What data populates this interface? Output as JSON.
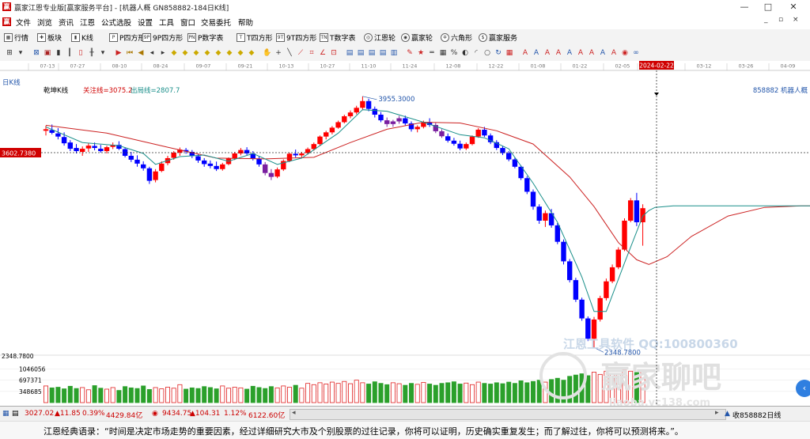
{
  "window": {
    "title": "赢家江恩专业版[赢家服务平台] - [机器人概 GN858882-184日K线]",
    "min": "—",
    "max": "□",
    "close": "✕"
  },
  "menu": {
    "items": [
      "文件",
      "浏览",
      "资讯",
      "江恩",
      "公式选股",
      "设置",
      "工具",
      "窗口",
      "交易委托",
      "帮助"
    ],
    "win_min": "_",
    "win_max": "▫",
    "win_close": "×"
  },
  "toolbar1": [
    {
      "label": "行情",
      "icon": "grid-icon",
      "glyph": "▦"
    },
    {
      "label": "板块",
      "icon": "puzzle-icon",
      "glyph": "✚"
    },
    {
      "label": "K线",
      "icon": "candle-icon",
      "glyph": "▮"
    },
    {
      "label": "P四方形",
      "icon": "p-square-icon",
      "glyph": "P"
    },
    {
      "label": "9P四方形",
      "icon": "9p-square-icon",
      "glyph": "9P"
    },
    {
      "label": "P数字表",
      "icon": "p-table-icon",
      "glyph": "PN"
    },
    {
      "label": "T四方形",
      "icon": "t-square-icon",
      "glyph": "T"
    },
    {
      "label": "9T四方形",
      "icon": "9t-square-icon",
      "glyph": "9T"
    },
    {
      "label": "T数字表",
      "icon": "t-table-icon",
      "glyph": "TN"
    },
    {
      "label": "江恩轮",
      "icon": "wheel-icon",
      "glyph": "◎"
    },
    {
      "label": "赢家轮",
      "icon": "winner-wheel-icon",
      "glyph": "◉"
    },
    {
      "label": "六角形",
      "icon": "hexagon-icon",
      "glyph": "✡"
    },
    {
      "label": "赢家服务",
      "icon": "dollar-icon",
      "glyph": "$"
    }
  ],
  "toolbar2": [
    {
      "icon": "crosshair-icon",
      "glyph": "⊞",
      "color": "#333333"
    },
    {
      "icon": "period-icon",
      "glyph": "▾",
      "color": "#333333"
    },
    {
      "icon": "swap-icon",
      "glyph": "⊠",
      "color": "#2255aa"
    },
    {
      "icon": "box-icon",
      "glyph": "▣",
      "color": "#aa2222"
    },
    {
      "icon": "candle-type-icon",
      "glyph": "▮",
      "color": "#333333"
    },
    {
      "icon": "bar-type-icon",
      "glyph": "┃",
      "color": "#333333"
    },
    {
      "icon": "candle-red-icon",
      "glyph": "▯",
      "color": "#cc2222"
    },
    {
      "icon": "ohlc-icon",
      "glyph": "╫",
      "color": "#333333"
    },
    {
      "icon": "period-select-icon",
      "glyph": "▾",
      "color": "#333333"
    },
    {
      "icon": "flag-icon",
      "glyph": "▶",
      "color": "#cc2222"
    },
    {
      "icon": "first-icon",
      "glyph": "⏮",
      "color": "#aa7700"
    },
    {
      "icon": "prev-page-icon",
      "glyph": "◀",
      "color": "#aa7700"
    },
    {
      "icon": "prev-icon",
      "glyph": "◂",
      "color": "#333333"
    },
    {
      "icon": "next-icon",
      "glyph": "▸",
      "color": "#333333"
    },
    {
      "icon": "zoom-in-icon",
      "glyph": "◆",
      "color": "#ccaa00"
    },
    {
      "icon": "zoom-out-icon",
      "glyph": "◆",
      "color": "#ccaa00"
    },
    {
      "icon": "shrink-icon",
      "glyph": "◆",
      "color": "#ccaa00"
    },
    {
      "icon": "expand-icon",
      "glyph": "◆",
      "color": "#ccaa00"
    },
    {
      "icon": "diamond-icon",
      "glyph": "◆",
      "color": "#ccaa00"
    },
    {
      "icon": "diamond2-icon",
      "glyph": "◆",
      "color": "#ccaa00"
    },
    {
      "icon": "diamond3-icon",
      "glyph": "◆",
      "color": "#ccaa00"
    },
    {
      "icon": "diamond4-icon",
      "glyph": "◆",
      "color": "#ccaa00"
    },
    {
      "icon": "hand-icon",
      "glyph": "✋",
      "color": "#333333"
    },
    {
      "icon": "cross-icon",
      "glyph": "+",
      "color": "#333333"
    },
    {
      "icon": "line-icon",
      "glyph": "╲",
      "color": "#333333"
    },
    {
      "icon": "gann-fan-icon",
      "glyph": "⟋",
      "color": "#cc2222"
    },
    {
      "icon": "gann-grid-icon",
      "glyph": "⌗",
      "color": "#cc2222"
    },
    {
      "icon": "gann-angle-icon",
      "glyph": "∠",
      "color": "#cc2222"
    },
    {
      "icon": "gann-box-icon",
      "glyph": "⊡",
      "color": "#cc2222"
    },
    {
      "icon": "save-icon",
      "glyph": "▤",
      "color": "#2255aa"
    },
    {
      "icon": "export-icon",
      "glyph": "▤",
      "color": "#2255aa"
    },
    {
      "icon": "print-icon",
      "glyph": "▤",
      "color": "#2255aa"
    },
    {
      "icon": "copy-icon",
      "glyph": "▤",
      "color": "#2255aa"
    },
    {
      "icon": "chart-icon",
      "glyph": "▥",
      "color": "#2255aa"
    },
    {
      "icon": "draw-icon",
      "glyph": "✎",
      "color": "#cc2222"
    },
    {
      "icon": "star-icon",
      "glyph": "★",
      "color": "#cc2222"
    },
    {
      "icon": "ruler-icon",
      "glyph": "═",
      "color": "#333333"
    },
    {
      "icon": "grid-lines-icon",
      "glyph": "▦",
      "color": "#333333"
    },
    {
      "icon": "percent-icon",
      "glyph": "%",
      "color": "#333333"
    },
    {
      "icon": "spiral-icon",
      "glyph": "◐",
      "color": "#333333"
    },
    {
      "icon": "arc-icon",
      "glyph": "◜",
      "color": "#333333"
    },
    {
      "icon": "circle-icon",
      "glyph": "○",
      "color": "#333333"
    },
    {
      "icon": "cycle-icon",
      "glyph": "↻",
      "color": "#2255aa"
    },
    {
      "icon": "calc-icon",
      "glyph": "▦",
      "color": "#cc2222"
    },
    {
      "icon": "aa-icon",
      "glyph": "A",
      "color": "#cc2222"
    },
    {
      "icon": "sa-icon",
      "glyph": "A",
      "color": "#2255aa"
    },
    {
      "icon": "ab-icon",
      "glyph": "A",
      "color": "#cc2222"
    },
    {
      "icon": "ac-icon",
      "glyph": "A",
      "color": "#cc2222"
    },
    {
      "icon": "ad-icon",
      "glyph": "A",
      "color": "#2255aa"
    },
    {
      "icon": "ae-icon",
      "glyph": "A",
      "color": "#cc2222"
    },
    {
      "icon": "af-icon",
      "glyph": "A",
      "color": "#cc2222"
    },
    {
      "icon": "ag-icon",
      "glyph": "A",
      "color": "#2255aa"
    },
    {
      "icon": "ah-icon",
      "glyph": "A",
      "color": "#cc2222"
    },
    {
      "icon": "color-icon",
      "glyph": "◉",
      "color": "#cc2222"
    },
    {
      "icon": "link-icon",
      "glyph": "∞",
      "color": "#2255aa"
    }
  ],
  "chart": {
    "period_label": "日K线",
    "indicator_name": "乾坤K线",
    "indicator_focus": "关注线=3075.2",
    "indicator_exit": "出局线=2807.7",
    "stock_label": "858882 机器人概",
    "cursor_price": "3602.7380",
    "cursor_date": "2024-02-22",
    "high_label": "3955.3000",
    "low_label": "2348.7800",
    "low_axis": "2348.7800",
    "vol_ticks": [
      "1046056",
      "697371",
      "348685"
    ],
    "watermark_top": "江恩工具软件 QQ:100800360",
    "watermark_mid": "赢家聊吧",
    "watermark_bottom": "liaoba.yc138.com"
  },
  "chart_data": {
    "type": "candlestick",
    "x_ticks": [
      "07-13",
      "07-27",
      "08-10",
      "08-24",
      "09-07",
      "09-21",
      "10-13",
      "10-27",
      "11-10",
      "11-24",
      "12-08",
      "12-22",
      "01-08",
      "01-22",
      "02-05",
      "2024-02-22",
      "03-12",
      "03-26",
      "04-09"
    ],
    "ohlc": [
      [
        3735,
        3768,
        3705,
        3745
      ],
      [
        3740,
        3775,
        3712,
        3722
      ],
      [
        3718,
        3752,
        3680,
        3698
      ],
      [
        3695,
        3725,
        3640,
        3655
      ],
      [
        3660,
        3675,
        3605,
        3620
      ],
      [
        3625,
        3650,
        3590,
        3605
      ],
      [
        3600,
        3635,
        3575,
        3620
      ],
      [
        3622,
        3655,
        3600,
        3640
      ],
      [
        3638,
        3660,
        3610,
        3625
      ],
      [
        3620,
        3645,
        3595,
        3605
      ],
      [
        3605,
        3640,
        3590,
        3630
      ],
      [
        3632,
        3660,
        3618,
        3645
      ],
      [
        3645,
        3668,
        3612,
        3620
      ],
      [
        3618,
        3630,
        3565,
        3575
      ],
      [
        3575,
        3600,
        3535,
        3550
      ],
      [
        3550,
        3578,
        3505,
        3525
      ],
      [
        3520,
        3540,
        3480,
        3495
      ],
      [
        3495,
        3505,
        3395,
        3415
      ],
      [
        3420,
        3490,
        3405,
        3475
      ],
      [
        3478,
        3540,
        3470,
        3525
      ],
      [
        3528,
        3575,
        3515,
        3560
      ],
      [
        3562,
        3605,
        3550,
        3595
      ],
      [
        3595,
        3628,
        3575,
        3615
      ],
      [
        3612,
        3625,
        3588,
        3602
      ],
      [
        3600,
        3612,
        3560,
        3575
      ],
      [
        3572,
        3585,
        3530,
        3545
      ],
      [
        3545,
        3560,
        3505,
        3522
      ],
      [
        3525,
        3545,
        3495,
        3510
      ],
      [
        3510,
        3538,
        3478,
        3490
      ],
      [
        3490,
        3530,
        3480,
        3520
      ],
      [
        3522,
        3565,
        3515,
        3558
      ],
      [
        3558,
        3600,
        3548,
        3590
      ],
      [
        3590,
        3625,
        3578,
        3612
      ],
      [
        3612,
        3630,
        3580,
        3590
      ],
      [
        3590,
        3605,
        3545,
        3558
      ],
      [
        3555,
        3570,
        3505,
        3520
      ],
      [
        3520,
        3535,
        3450,
        3465
      ],
      [
        3465,
        3490,
        3420,
        3440
      ],
      [
        3442,
        3500,
        3432,
        3488
      ],
      [
        3488,
        3552,
        3478,
        3542
      ],
      [
        3542,
        3595,
        3535,
        3588
      ],
      [
        3588,
        3615,
        3565,
        3578
      ],
      [
        3578,
        3600,
        3558,
        3590
      ],
      [
        3592,
        3628,
        3582,
        3618
      ],
      [
        3618,
        3660,
        3608,
        3650
      ],
      [
        3650,
        3705,
        3640,
        3698
      ],
      [
        3698,
        3735,
        3680,
        3725
      ],
      [
        3725,
        3765,
        3712,
        3755
      ],
      [
        3755,
        3800,
        3748,
        3790
      ],
      [
        3790,
        3838,
        3782,
        3828
      ],
      [
        3828,
        3865,
        3815,
        3852
      ],
      [
        3852,
        3895,
        3840,
        3882
      ],
      [
        3882,
        3955,
        3870,
        3925
      ],
      [
        3925,
        3940,
        3860,
        3875
      ],
      [
        3875,
        3890,
        3820,
        3838
      ],
      [
        3838,
        3855,
        3790,
        3802
      ],
      [
        3802,
        3820,
        3760,
        3778
      ],
      [
        3778,
        3805,
        3760,
        3795
      ],
      [
        3795,
        3830,
        3780,
        3815
      ],
      [
        3815,
        3832,
        3770,
        3782
      ],
      [
        3782,
        3795,
        3730,
        3745
      ],
      [
        3745,
        3770,
        3725,
        3760
      ],
      [
        3760,
        3800,
        3750,
        3788
      ],
      [
        3788,
        3815,
        3760,
        3772
      ],
      [
        3772,
        3785,
        3720,
        3732
      ],
      [
        3732,
        3745,
        3690,
        3700
      ],
      [
        3700,
        3718,
        3660,
        3672
      ],
      [
        3672,
        3690,
        3640,
        3652
      ],
      [
        3652,
        3672,
        3610,
        3622
      ],
      [
        3622,
        3660,
        3612,
        3650
      ],
      [
        3650,
        3705,
        3642,
        3698
      ],
      [
        3698,
        3752,
        3690,
        3742
      ],
      [
        3742,
        3760,
        3695,
        3705
      ],
      [
        3705,
        3718,
        3650,
        3662
      ],
      [
        3662,
        3675,
        3612,
        3625
      ],
      [
        3625,
        3638,
        3580,
        3592
      ],
      [
        3592,
        3605,
        3540,
        3552
      ],
      [
        3552,
        3565,
        3495,
        3505
      ],
      [
        3505,
        3515,
        3420,
        3432
      ],
      [
        3432,
        3445,
        3330,
        3345
      ],
      [
        3345,
        3360,
        3230,
        3250
      ],
      [
        3250,
        3265,
        3140,
        3160
      ],
      [
        3160,
        3225,
        3120,
        3208
      ],
      [
        3208,
        3235,
        3115,
        3130
      ],
      [
        3130,
        3145,
        3010,
        3025
      ],
      [
        3025,
        3040,
        2880,
        2900
      ],
      [
        2900,
        2915,
        2765,
        2780
      ],
      [
        2780,
        2795,
        2640,
        2655
      ],
      [
        2655,
        2668,
        2520,
        2535
      ],
      [
        2535,
        2548,
        2390,
        2405
      ],
      [
        2405,
        2545,
        2349,
        2528
      ],
      [
        2528,
        2680,
        2515,
        2665
      ],
      [
        2665,
        2790,
        2650,
        2772
      ],
      [
        2772,
        2880,
        2760,
        2862
      ],
      [
        2862,
        2990,
        2850,
        2975
      ],
      [
        2975,
        3175,
        2965,
        3160
      ],
      [
        3160,
        3305,
        3150,
        3290
      ],
      [
        3290,
        3338,
        3125,
        3150
      ],
      [
        3150,
        3265,
        3000,
        3240
      ]
    ],
    "ma_fast": [
      [
        0,
        3760
      ],
      [
        6,
        3660
      ],
      [
        12,
        3640
      ],
      [
        16,
        3590
      ],
      [
        18,
        3520
      ],
      [
        22,
        3570
      ],
      [
        26,
        3580
      ],
      [
        30,
        3540
      ],
      [
        34,
        3590
      ],
      [
        38,
        3520
      ],
      [
        42,
        3560
      ],
      [
        48,
        3720
      ],
      [
        52,
        3870
      ],
      [
        56,
        3860
      ],
      [
        62,
        3790
      ],
      [
        68,
        3710
      ],
      [
        72,
        3690
      ],
      [
        76,
        3620
      ],
      [
        80,
        3400
      ],
      [
        84,
        3150
      ],
      [
        88,
        2800
      ],
      [
        90,
        2580
      ],
      [
        92,
        2580
      ],
      [
        95,
        2890
      ],
      [
        98,
        3190
      ],
      [
        99,
        3225
      ],
      [
        100,
        3245
      ],
      [
        103,
        3255
      ],
      [
        130,
        3255
      ]
    ],
    "ma_slow": [
      [
        0,
        3770
      ],
      [
        10,
        3720
      ],
      [
        20,
        3630
      ],
      [
        28,
        3560
      ],
      [
        36,
        3555
      ],
      [
        44,
        3565
      ],
      [
        50,
        3660
      ],
      [
        56,
        3745
      ],
      [
        62,
        3790
      ],
      [
        68,
        3785
      ],
      [
        74,
        3735
      ],
      [
        80,
        3650
      ],
      [
        86,
        3440
      ],
      [
        90,
        3250
      ],
      [
        94,
        3020
      ],
      [
        97,
        2910
      ],
      [
        99,
        2880
      ],
      [
        102,
        2930
      ],
      [
        106,
        3060
      ],
      [
        112,
        3190
      ],
      [
        118,
        3245
      ],
      [
        124,
        3255
      ],
      [
        130,
        3255
      ]
    ],
    "volume": [
      520,
      460,
      480,
      430,
      510,
      440,
      470,
      400,
      530,
      450,
      420,
      470,
      380,
      500,
      460,
      440,
      520,
      410,
      470,
      430,
      480,
      450,
      560,
      420,
      460,
      440,
      500,
      470,
      430,
      520,
      450,
      480,
      460,
      420,
      510,
      470,
      440,
      500,
      460,
      520,
      480,
      540,
      450,
      600,
      560,
      620,
      580,
      640,
      600,
      660,
      590,
      700,
      620,
      580,
      650,
      600,
      560,
      620,
      590,
      540,
      600,
      570,
      630,
      580,
      540,
      600,
      620,
      650,
      580,
      610,
      560,
      640,
      600,
      580,
      620,
      590,
      640,
      600,
      680,
      620,
      660,
      700,
      640,
      720,
      760,
      700,
      820,
      860,
      900,
      840,
      950,
      880,
      980,
      900,
      860,
      1020,
      980,
      940,
      1000
    ],
    "ylim": [
      2300,
      4020
    ],
    "vol_ylim": [
      0,
      1110000
    ]
  },
  "status": {
    "index1": "3027.02",
    "index1_chg": "▲11.85",
    "index1_pct": "0.39%",
    "index1_amt": "4429.84亿",
    "index2": "9434.75",
    "index2_chg": "▲104.31",
    "index2_pct": "1.12%",
    "index2_amt": "6122.60亿",
    "right": "收858882日线"
  },
  "quote": "江恩经典语录：“时间是决定市场走势的重要因素，经过详细研究大市及个别股票的过往记录，你将可以证明，历史确实重复发生；而了解过往，你将可以预测将来。”。",
  "colors": {
    "up": "#ff0000",
    "down": "#0000ff",
    "purple": "#7a1fa0",
    "ma_fast": "#1a8f8a",
    "ma_slow": "#cc2222"
  }
}
